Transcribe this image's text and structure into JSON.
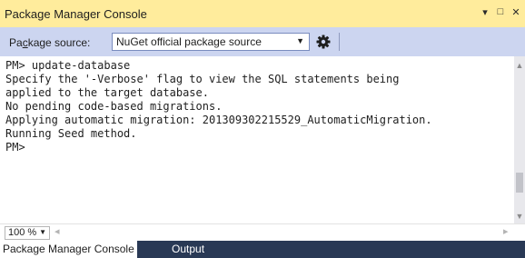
{
  "window": {
    "title": "Package Manager Console",
    "controls": [
      "dropdown-arrow",
      "maximize",
      "close"
    ]
  },
  "toolbar": {
    "source_label_pre": "Pa",
    "source_label_accel": "c",
    "source_label_post": "kage source:",
    "source_value": "NuGet official package source",
    "settings_icon": "gear-icon"
  },
  "console": {
    "lines": [
      "PM> update-database",
      "Specify the '-Verbose' flag to view the SQL statements being",
      "applied to the target database.",
      "No pending code-based migrations.",
      "Applying automatic migration: 201309302215529_AutomaticMigration.",
      "Running Seed method.",
      "PM>"
    ]
  },
  "status": {
    "zoom": "100 %"
  },
  "tabs": [
    {
      "label": "Package Manager Console",
      "active": true
    },
    {
      "label": "Output",
      "active": false
    }
  ],
  "colors": {
    "title_bar": "#ffec9c",
    "toolbar": "#ccd5f0",
    "tab_strip": "#293955"
  }
}
